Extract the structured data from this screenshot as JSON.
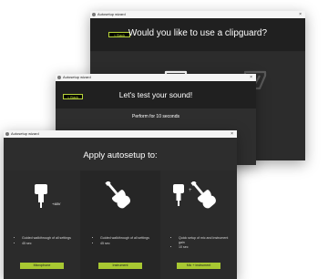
{
  "windows": [
    {
      "title_bar": "Autosetup wizard",
      "back_label": "< Back",
      "heading": "Would you like to use a clipguard?"
    },
    {
      "title_bar": "Autosetup wizard",
      "back_label": "< Back",
      "heading": "Let's test your sound!",
      "body_text": "Perform for 10 seconds"
    },
    {
      "title_bar": "Autosetup wizard",
      "heading": "Apply autosetup to:",
      "options": [
        {
          "icon": "microphone-icon",
          "badge": "+48V",
          "bullets": [
            "Guided walkthrough of all settings",
            "45 sec"
          ],
          "button": "Microphone"
        },
        {
          "icon": "guitar-icon",
          "bullets": [
            "Guided walkthrough of all settings",
            "45 sec"
          ],
          "button": "Instrument"
        },
        {
          "icon": "mic-plus-guitar-icon",
          "plus": "+",
          "bullets": [
            "Quick setup of mic and instrument gain",
            "10 sec"
          ],
          "button": "Mic + instrument"
        }
      ]
    }
  ],
  "colors": {
    "accent": "#a8c832",
    "window_bg": "#2b2b2b",
    "titlebar_bg": "#f4f4f4"
  }
}
